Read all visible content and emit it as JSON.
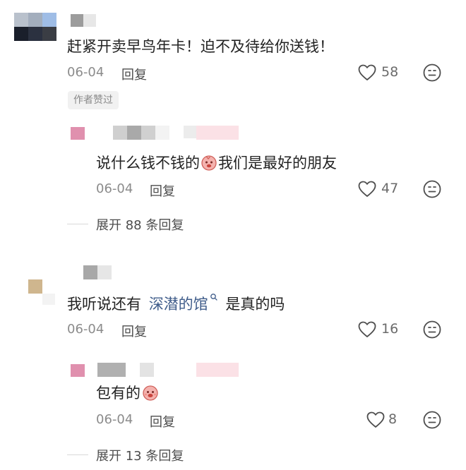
{
  "comments": [
    {
      "text": "赶紧开卖早鸟年卡！迫不及待给你送钱！",
      "date": "06-04",
      "reply_label": "回复",
      "likes": "58",
      "badge": "作者赞过",
      "replies": [
        {
          "text_before": "说什么钱不钱的",
          "text_after": "我们是最好的朋友",
          "date": "06-04",
          "reply_label": "回复",
          "likes": "47"
        }
      ],
      "expand_label": "展开 88 条回复"
    },
    {
      "text_before": "我听说还有",
      "link_text": "深潜的馆",
      "text_after": "是真的吗",
      "date": "06-04",
      "reply_label": "回复",
      "likes": "16",
      "replies": [
        {
          "text": "包有的",
          "date": "06-04",
          "reply_label": "回复",
          "likes": "8"
        }
      ],
      "expand_label": "展开 13 条回复"
    }
  ],
  "icons": {
    "like": "heart-outline-icon",
    "emoji": "neutral-face-icon",
    "sticker": "pink-face-sticker-icon",
    "search": "search-icon"
  },
  "colors": {
    "link": "#3f5c8a",
    "meta": "#8b8b8b",
    "text": "#232323"
  }
}
